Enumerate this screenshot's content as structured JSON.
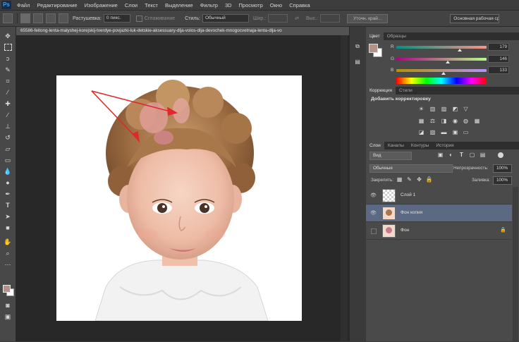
{
  "app": {
    "logo": "Ps"
  },
  "menu": [
    "Файл",
    "Редактирование",
    "Изображение",
    "Слои",
    "Текст",
    "Выделение",
    "Фильтр",
    "3D",
    "Просмотр",
    "Окно",
    "Справка"
  ],
  "options": {
    "feather_label": "Растушевка:",
    "feather_value": "0 пикс.",
    "antialias_label": "Сглаживание",
    "style_label": "Стиль:",
    "style_value": "Обычный",
    "width_label": "Шир.:",
    "height_label": "Выс.:",
    "refine_button": "Уточн. край...",
    "workspace": "Основная рабочая среда"
  },
  "document": {
    "tab_title": "65586-feitong-lenta-malyshej-korejskij-tverdye-povjazki-luk-detskie-aksessuary-dlja-volos-dlja-devochek-mnogocvetnaja-lenta-dlja-vo"
  },
  "color_panel": {
    "tabs": [
      "Цвет",
      "Образцы"
    ],
    "channels": [
      {
        "label": "R",
        "value": "179",
        "fraction": 0.7
      },
      {
        "label": "G",
        "value": "146",
        "fraction": 0.57
      },
      {
        "label": "B",
        "value": "133",
        "fraction": 0.52
      }
    ],
    "fg_color": "#b3928a",
    "bg_color": "#ffffff"
  },
  "adjustments_panel": {
    "tabs": [
      "Коррекция",
      "Стили"
    ],
    "title": "Добавить корректировку"
  },
  "layers_panel": {
    "tabs": [
      "Слои",
      "Каналы",
      "Контуры",
      "История"
    ],
    "filter_value": "Вид",
    "blend_mode": "Обычные",
    "opacity_label": "Непрозрачность:",
    "opacity_value": "100%",
    "lock_label": "Закрепить:",
    "fill_label": "Заливка:",
    "fill_value": "100%",
    "layers": [
      {
        "name": "Слой 1",
        "visible": true,
        "selected": false
      },
      {
        "name": "Фон копия",
        "visible": true,
        "selected": true
      },
      {
        "name": "Фон",
        "visible": false,
        "selected": false
      }
    ]
  },
  "colors": {
    "selection": "#5b6a82",
    "arrow": "#e0282d"
  }
}
